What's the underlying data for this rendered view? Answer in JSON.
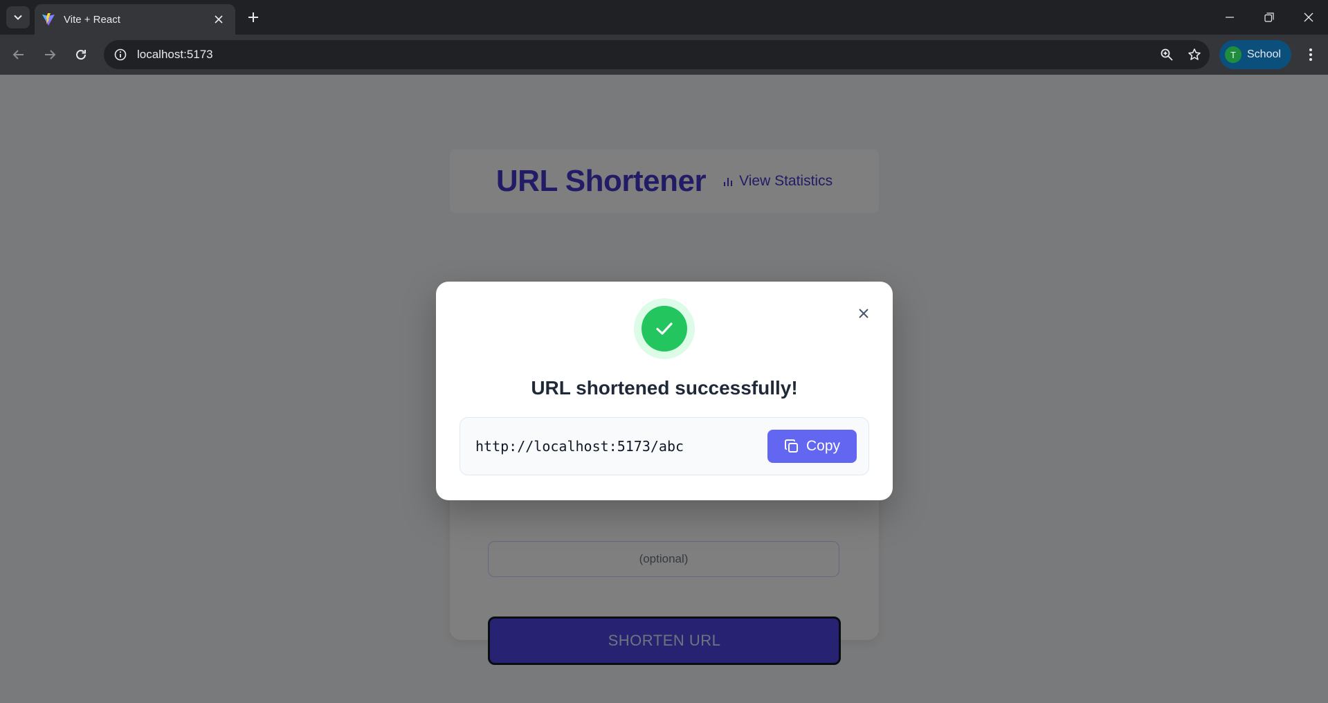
{
  "browser": {
    "tab_title": "Vite + React",
    "address": "localhost:5173",
    "profile_initial": "T",
    "profile_label": "School",
    "icons": [
      "tab-search-icon",
      "vite-favicon-icon",
      "close-icon",
      "plus-icon",
      "minimize-icon",
      "restore-icon",
      "back-icon",
      "forward-icon",
      "reload-icon",
      "info-icon",
      "zoom-icon",
      "star-icon",
      "more-vert-icon"
    ]
  },
  "page": {
    "title": "URL Shortener",
    "stats_link": "View Statistics",
    "alias_placeholder": "(optional)",
    "shorten_button": "SHORTEN URL"
  },
  "modal": {
    "message": "URL shortened successfully!",
    "short_url": "http://localhost:5173/abc",
    "copy_label": "Copy"
  },
  "colors": {
    "accent": "#4338ca",
    "button": "#4f46e5",
    "copy_button": "#6366f1",
    "success": "#22c55e"
  }
}
